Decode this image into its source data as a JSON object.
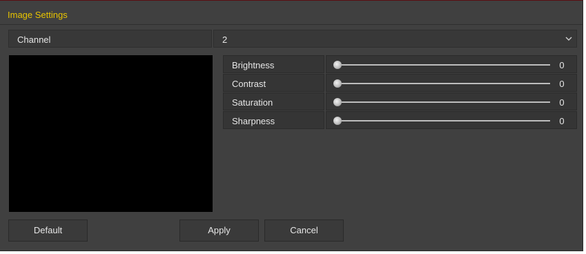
{
  "dialog": {
    "title": "Image Settings",
    "title_color": "#e8c400"
  },
  "channel": {
    "label": "Channel",
    "value": "2",
    "dropdown_icon": "chevron-down-icon"
  },
  "preview": {
    "background": "#000000"
  },
  "sliders": [
    {
      "label": "Brightness",
      "value": "0"
    },
    {
      "label": "Contrast",
      "value": "0"
    },
    {
      "label": "Saturation",
      "value": "0"
    },
    {
      "label": "Sharpness",
      "value": "0"
    }
  ],
  "buttons": {
    "default_label": "Default",
    "apply_label": "Apply",
    "cancel_label": "Cancel"
  }
}
